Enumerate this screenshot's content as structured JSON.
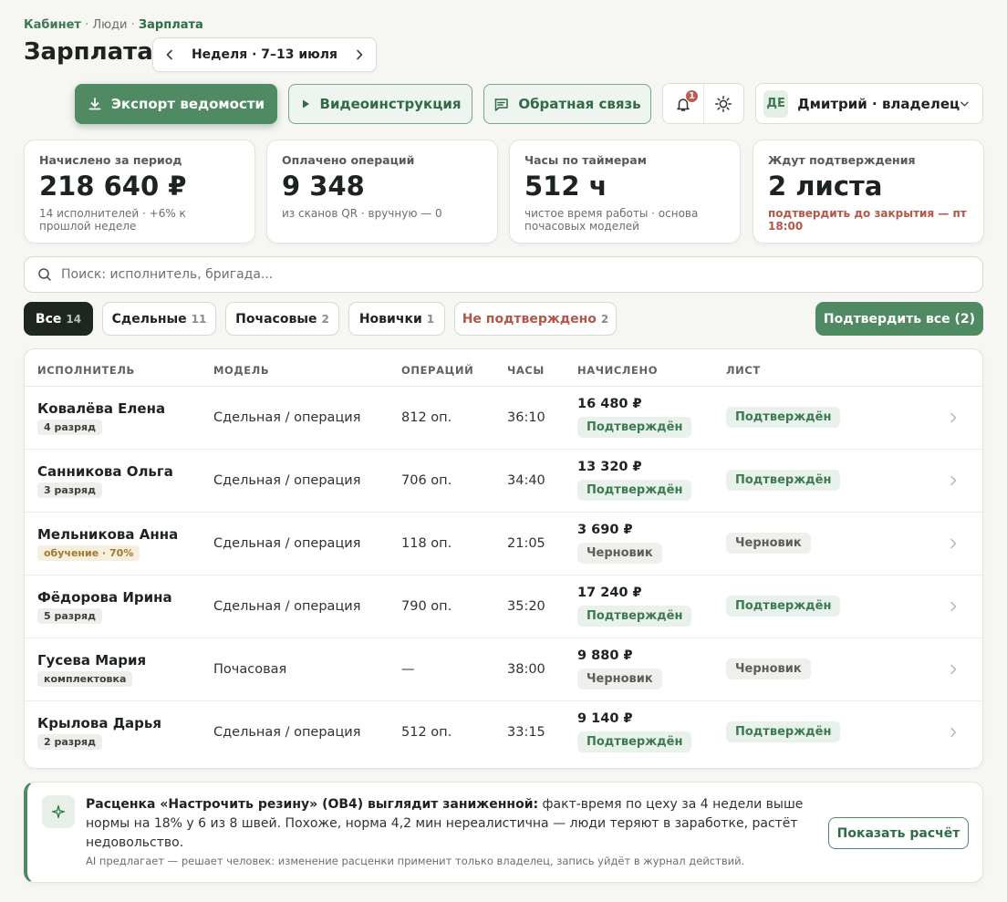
{
  "breadcrumb": {
    "root": "Кабинет",
    "middle": "Люди",
    "current": "Зарплата",
    "separator": "·"
  },
  "page": {
    "title": "Зарплата"
  },
  "week": {
    "label": "Неделя · 7–13 июля"
  },
  "toolbar": {
    "export_label": "Экспорт ведомости",
    "video_label": "Видеоинструкция",
    "feedback_label": "Обратная связь",
    "notifications_count": "1"
  },
  "user": {
    "initials": "ДЕ",
    "name": "Дмитрий · владелец"
  },
  "stats": [
    {
      "label": "Начислено за период",
      "value": "218 640 ₽",
      "sub": "14 исполнителей · +6% к прошлой неделе"
    },
    {
      "label": "Оплачено операций",
      "value": "9 348",
      "sub": "из сканов QR · вручную — 0"
    },
    {
      "label": "Часы по таймерам",
      "value": "512 ч",
      "sub": "чистое время работы · основа почасовых моделей"
    },
    {
      "label": "Ждут подтверждения",
      "value": "2 листа",
      "sub": "подтвердить до закрытия — пт 18:00"
    }
  ],
  "search": {
    "placeholder": "Поиск: исполнитель, бригада..."
  },
  "filters": [
    {
      "label": "Все",
      "count": "14"
    },
    {
      "label": "Сдельные",
      "count": "11"
    },
    {
      "label": "Почасовые",
      "count": "2"
    },
    {
      "label": "Новички",
      "count": "1"
    },
    {
      "label": "Не подтверждено",
      "count": "2"
    }
  ],
  "confirm_all_label": "Подтвердить все (2)",
  "table": {
    "columns": [
      "ИСПОЛНИТЕЛЬ",
      "МОДЕЛЬ",
      "ОПЕРАЦИЙ",
      "ЧАСЫ",
      "НАЧИСЛЕНО",
      "ЛИСТ"
    ],
    "rows": [
      {
        "name": "Ковалёва Елена",
        "tag": "4 разряд",
        "model": "Сдельная / операция",
        "ops": "812 оп.",
        "hours": "36:10",
        "amount": "16 480 ₽",
        "status": "Подтверждён",
        "sheet": "Подтверждён"
      },
      {
        "name": "Санникова Ольга",
        "tag": "3 разряд",
        "model": "Сдельная / операция",
        "ops": "706 оп.",
        "hours": "34:40",
        "amount": "13 320 ₽",
        "status": "Подтверждён",
        "sheet": "Подтверждён"
      },
      {
        "name": "Мельникова Анна",
        "tag": "обучение · 70%",
        "model": "Сдельная / операция",
        "ops": "118 оп.",
        "hours": "21:05",
        "amount": "3 690 ₽",
        "status": "Черновик",
        "sheet": "Черновик"
      },
      {
        "name": "Фёдорова Ирина",
        "tag": "5 разряд",
        "model": "Сдельная / операция",
        "ops": "790 оп.",
        "hours": "35:20",
        "amount": "17 240 ₽",
        "status": "Подтверждён",
        "sheet": "Подтверждён"
      },
      {
        "name": "Гусева Мария",
        "tag": "комплектовка",
        "model": "Почасовая",
        "ops": "—",
        "hours": "38:00",
        "amount": "9 880 ₽",
        "status": "Черновик",
        "sheet": "Черновик"
      },
      {
        "name": "Крылова Дарья",
        "tag": "2 разряд",
        "model": "Сдельная / операция",
        "ops": "512 оп.",
        "hours": "33:15",
        "amount": "9 140 ₽",
        "status": "Подтверждён",
        "sheet": "Подтверждён"
      }
    ]
  },
  "ai": {
    "headline": "Расценка «Настрочить резину» (ОВ4) выглядит заниженной:",
    "body": " факт-время по цеху за 4 недели выше нормы на 18% у 6 из 8 швей. Похоже, норма 4,2 мин нереалистична — люди теряют в заработке, растёт недовольство.",
    "note": "AI предлагает — решает человек: изменение расценки применит только владелец, запись уйдёт в журнал действий.",
    "button": "Показать расчёт"
  },
  "colors": {
    "accent": "#4f8a63",
    "warning": "#b2564a",
    "dark_chip": "#1f261f"
  }
}
